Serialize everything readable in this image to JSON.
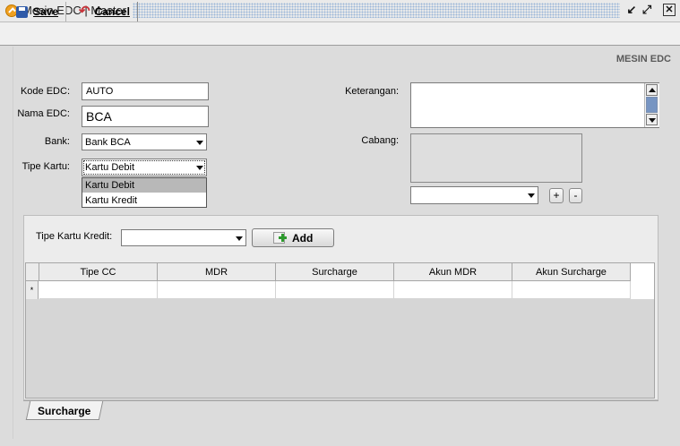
{
  "window": {
    "title": "Mesin EDC | Master",
    "controls": [
      "restore-icon",
      "maximize-icon",
      "close-icon"
    ]
  },
  "toolbar": {
    "save_label": "Save",
    "cancel_label": "Cancel"
  },
  "section_title": "MESIN EDC",
  "form": {
    "kode_edc_label": "Kode EDC:",
    "kode_edc_value": "AUTO",
    "nama_edc_label": "Nama EDC:",
    "nama_edc_value": "BCA",
    "bank_label": "Bank:",
    "bank_value": "Bank BCA",
    "tipe_kartu_label": "Tipe Kartu:",
    "tipe_kartu_value": "Kartu Debit",
    "tipe_kartu_options": [
      "Kartu Debit",
      "Kartu Kredit"
    ],
    "tipe_kartu_highlighted": "Kartu Debit",
    "keterangan_label": "Keterangan:",
    "keterangan_value": "",
    "cabang_label": "Cabang:",
    "cabang_select_value": "",
    "add_cabang_label": "+",
    "remove_cabang_label": "-"
  },
  "surcharge_tab": {
    "tipe_kartu_kredit_label": "Tipe Kartu Kredit:",
    "tipe_kartu_kredit_value": "",
    "add_label": "Add",
    "grid_columns": [
      "Tipe CC",
      "MDR",
      "Surcharge",
      "Akun MDR",
      "Akun Surcharge"
    ],
    "new_row_marker": "*",
    "tab_label": "Surcharge"
  },
  "colors": {
    "window_bg": "#dcdcdc",
    "titlebar_pattern": "#9ab6d8",
    "save_icon": "#2f5aa8",
    "cancel_icon": "#c8343a",
    "add_icon": "#2d9a2d",
    "app_icon": "#f0a020"
  }
}
